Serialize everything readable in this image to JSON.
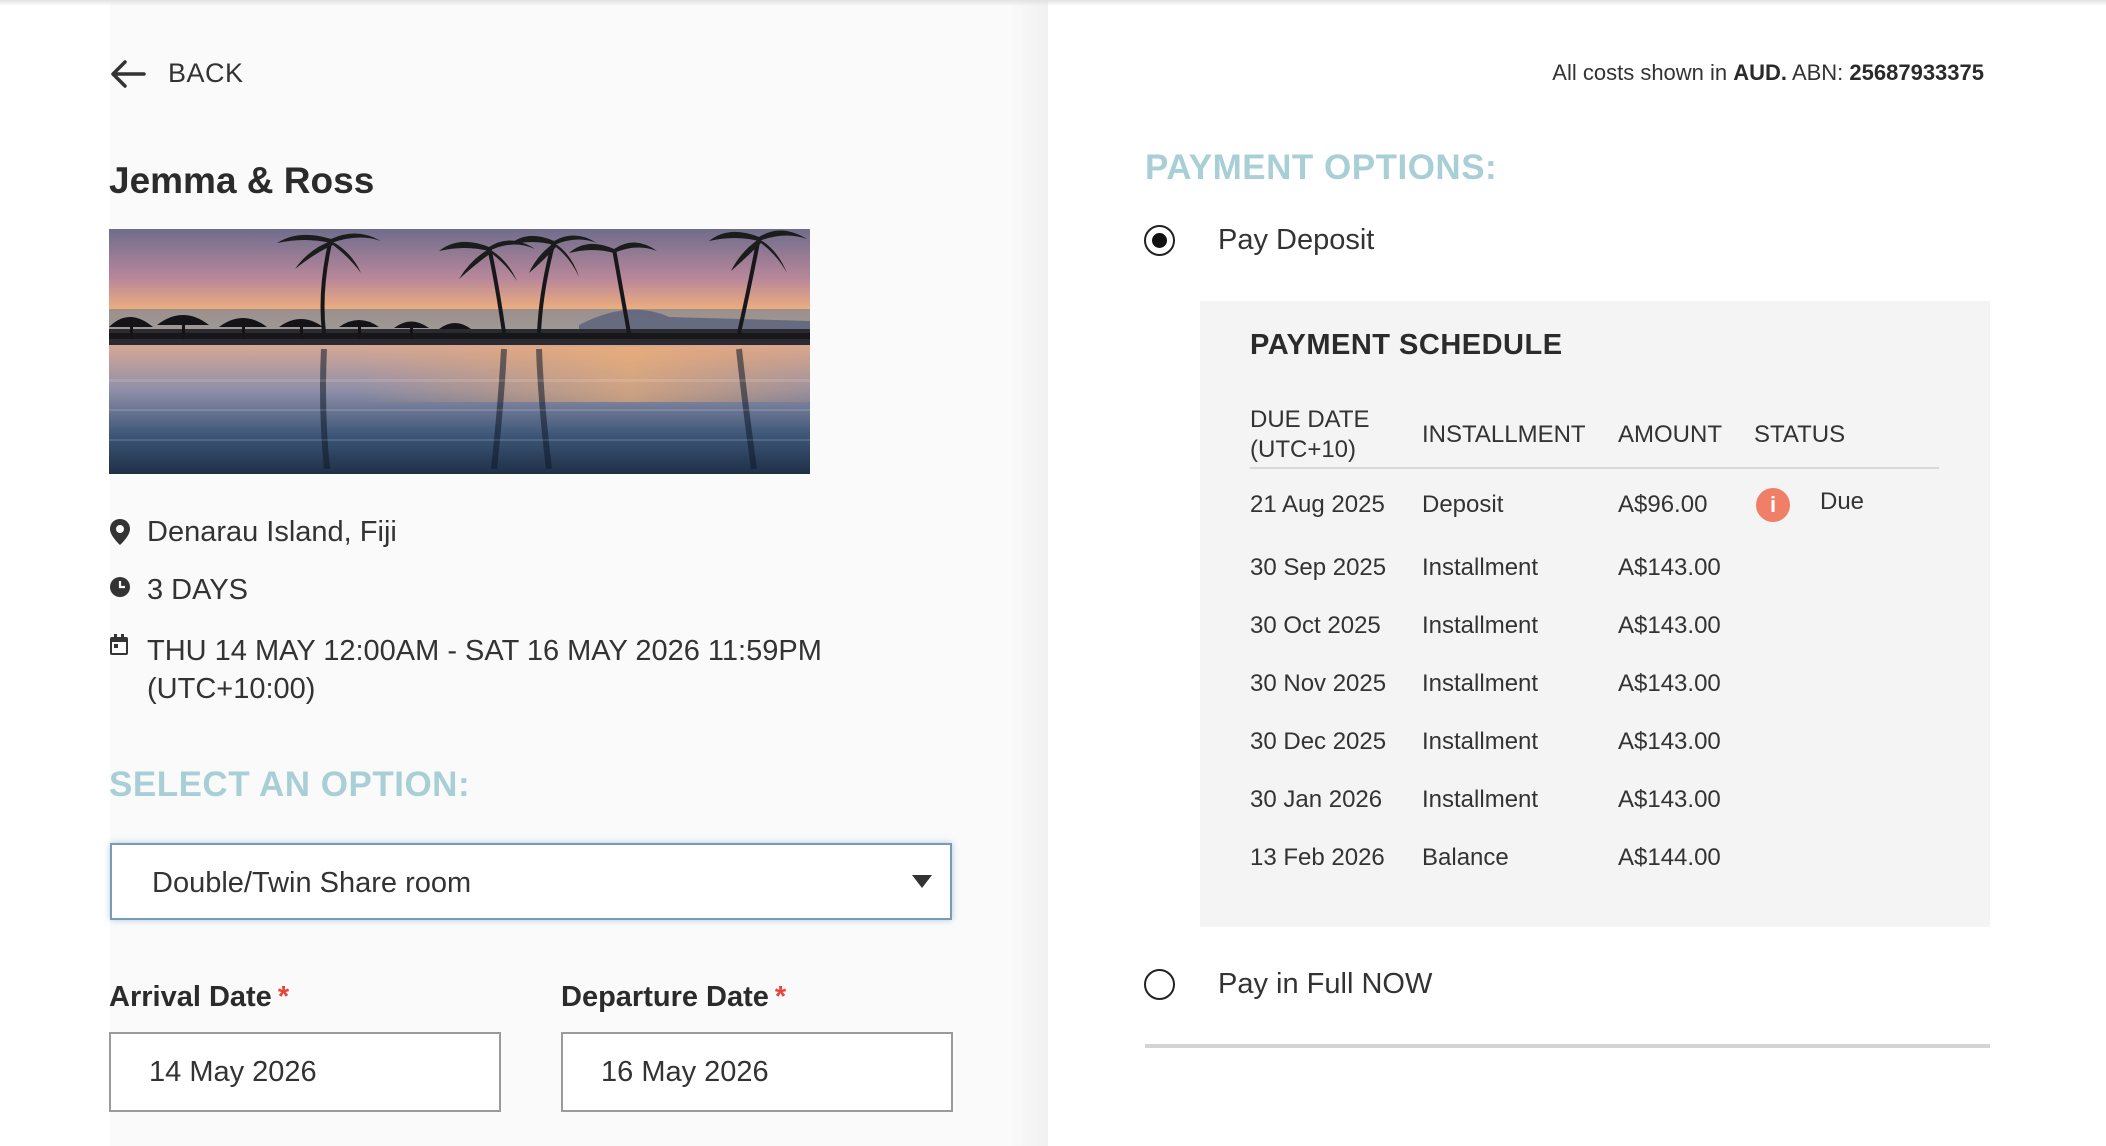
{
  "nav": {
    "back_label": "BACK"
  },
  "event": {
    "title": "Jemma & Ross",
    "location": "Denarau Island, Fiji",
    "duration": "3 DAYS",
    "datetime_line1": "THU 14 MAY 12:00AM - SAT 16 MAY 2026 11:59PM",
    "datetime_line2": "(UTC+10:00)"
  },
  "options": {
    "heading": "SELECT AN OPTION:",
    "selected": "Double/Twin Share room"
  },
  "dates": {
    "arrival_label": "Arrival Date",
    "departure_label": "Departure Date",
    "required_mark": "*",
    "arrival_value": "14 May 2026",
    "departure_value": "16 May 2026"
  },
  "costs": {
    "prefix": "All costs shown in ",
    "currency": "AUD.",
    "abn_label": " ABN: ",
    "abn": "25687933375"
  },
  "payment": {
    "heading": "PAYMENT OPTIONS:",
    "deposit_label": "Pay Deposit",
    "deposit_selected": true,
    "full_label": "Pay in Full NOW",
    "full_selected": false
  },
  "schedule": {
    "title": "PAYMENT SCHEDULE",
    "headers": {
      "due_date_line1": "DUE DATE",
      "due_date_line2": "(UTC+10)",
      "installment": "INSTALLMENT",
      "amount": "AMOUNT",
      "status": "STATUS"
    },
    "rows": [
      {
        "date": "21 Aug 2025",
        "type": "Deposit",
        "amount": "A$96.00",
        "status": "Due"
      },
      {
        "date": "30 Sep 2025",
        "type": "Installment",
        "amount": "A$143.00",
        "status": ""
      },
      {
        "date": "30 Oct 2025",
        "type": "Installment",
        "amount": "A$143.00",
        "status": ""
      },
      {
        "date": "30 Nov 2025",
        "type": "Installment",
        "amount": "A$143.00",
        "status": ""
      },
      {
        "date": "30 Dec 2025",
        "type": "Installment",
        "amount": "A$143.00",
        "status": ""
      },
      {
        "date": "30 Jan 2026",
        "type": "Installment",
        "amount": "A$143.00",
        "status": ""
      },
      {
        "date": "13 Feb 2026",
        "type": "Balance",
        "amount": "A$144.00",
        "status": ""
      }
    ]
  },
  "icons": {
    "back": "arrow-left-icon",
    "location": "map-pin-icon",
    "duration": "clock-icon",
    "date": "calendar-icon",
    "status": "info-icon",
    "dropdown": "chevron-down-icon"
  },
  "colors": {
    "section_heading": "#a9cfd6",
    "required": "#e4463b",
    "status_due": "#ef7f66",
    "schedule_bg": "#f4f4f4",
    "select_border": "#7a9bb5"
  }
}
